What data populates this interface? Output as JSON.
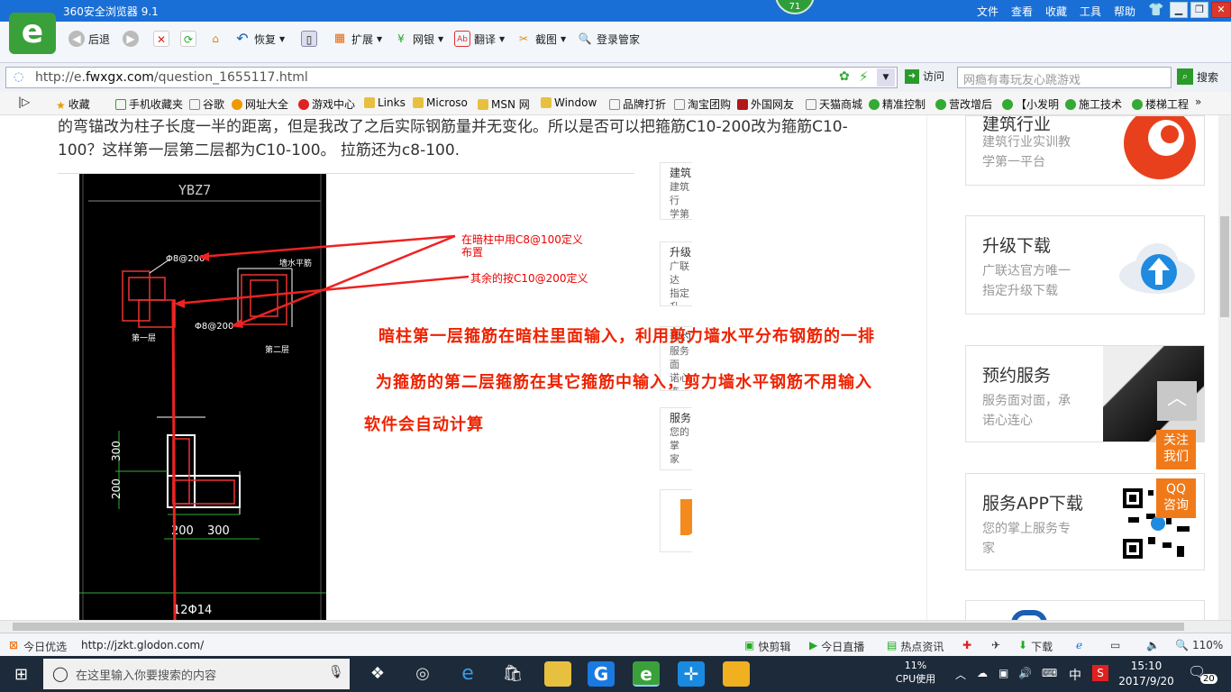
{
  "browser": {
    "title": "360安全浏览器 9.1",
    "badge": "71",
    "menu": [
      "文件",
      "查看",
      "收藏",
      "工具",
      "帮助"
    ],
    "toolbar": {
      "back": "后退",
      "restore": "恢复",
      "extend": "扩展",
      "bank": "网银",
      "translate": "翻译",
      "screenshot": "截图",
      "login": "登录管家"
    },
    "address": {
      "prefix": "http://e.",
      "host": "fwxgx.com",
      "path": "/question_1655117.html",
      "visit_label": "访问"
    },
    "search": {
      "placeholder": "网瘾有毒玩友心跳游戏",
      "button": "搜索"
    },
    "bookmarks": [
      "收藏",
      "手机收藏夹",
      "谷歌",
      "网址大全",
      "游戏中心",
      "Links",
      "Microso",
      "MSN 网",
      "Window",
      "品牌打折",
      "淘宝团购",
      "外国网友",
      "天猫商城",
      "精准控制",
      "营改增后",
      "【小发明",
      "施工技术",
      "楼梯工程"
    ]
  },
  "page": {
    "question_line1": "的弯锚改为柱子长度一半的距离，但是我改了之后实际钢筋量并无变化。所以是否可以把箍筋C10-200改为箍筋C10-",
    "question_line2": "100？这样第一层第二层都为C10-100。 拉筋还为c8-100.",
    "cad": {
      "title": "YBZ7",
      "label_a": "Φ8@200",
      "label_b": "Φ8@200",
      "label_c": "墙水平筋",
      "label_d": "第一层",
      "label_e": "第二层",
      "dim_300v": "300",
      "dim_200v": "200",
      "dim_200h": "200",
      "dim_300h": "300",
      "bottom": "12Φ14"
    },
    "annotation1_l1": "在暗柱中用C8@100定义",
    "annotation1_l2": "布置",
    "annotation2": "其余的按C10@200定义",
    "red_text1": "暗柱第一层箍筋在暗柱里面输入，利用剪力墙水平分布钢筋的一排",
    "red_text2": "为箍筋的第二层箍筋在其它箍筋中输入，剪力墙水平钢筋不用输入",
    "red_text3": "软件会自动计算",
    "mid_cards": [
      {
        "title": "建筑",
        "desc1": "建筑行",
        "desc2": "学第一"
      },
      {
        "title": "升级",
        "desc1": "广联达",
        "desc2": "指定升"
      },
      {
        "title": "预约",
        "desc1": "服务面",
        "desc2": "诺心连"
      },
      {
        "title": "服务",
        "desc1": "您的掌",
        "desc2": "家"
      }
    ],
    "right_cards": [
      {
        "title": "建筑行业",
        "desc1": "建筑行业实训教",
        "desc2": "学第一平台"
      },
      {
        "title": "升级下载",
        "desc1": "广联达官方唯一",
        "desc2": "指定升级下载"
      },
      {
        "title": "预约服务",
        "desc1": "服务面对面，承",
        "desc2": "诺心连心"
      },
      {
        "title": "服务APP下载",
        "desc1": "您的掌上服务专",
        "desc2": "家"
      }
    ],
    "side_follow": "关注我们",
    "side_qq": "QQ咨询"
  },
  "statusbar": {
    "left": "今日优选",
    "url": "http://jzkt.glodon.com/",
    "items": [
      "快剪辑",
      "今日直播",
      "热点资讯",
      "下载"
    ],
    "zoom": "110%"
  },
  "taskbar": {
    "search_placeholder": "在这里输入你要搜索的内容",
    "cpu_percent": "11%",
    "cpu_label": "CPU使用",
    "ime": "中",
    "time": "15:10",
    "date": "2017/9/20",
    "notifications": "20"
  },
  "colors": {
    "title_blue": "#1a6fd6",
    "red_text": "#e62010",
    "side_orange": "#f07a1a",
    "taskbar": "#1c2a3a"
  }
}
